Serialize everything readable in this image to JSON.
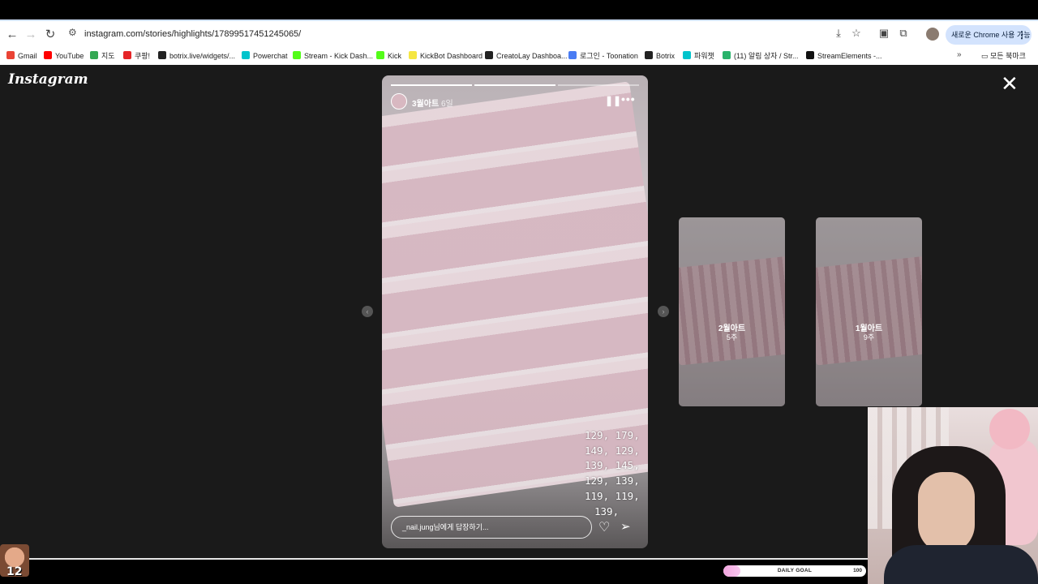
{
  "browser": {
    "url": "instagram.com/stories/highlights/17899517451245065/",
    "update_label": "새로운 Chrome 사용 가능",
    "bookmarks": [
      {
        "label": "Gmail",
        "color": "#ea4335"
      },
      {
        "label": "YouTube",
        "color": "#ff0000"
      },
      {
        "label": "지도",
        "color": "#34a853"
      },
      {
        "label": "쿠팡!",
        "color": "#e52528"
      },
      {
        "label": "botrix.live/widgets/...",
        "color": "#222222"
      },
      {
        "label": "Powerchat",
        "color": "#00c4cc"
      },
      {
        "label": "Stream - Kick Dash...",
        "color": "#53fc18"
      },
      {
        "label": "Kick",
        "color": "#53fc18"
      },
      {
        "label": "KickBot Dashboard",
        "color": "#f5e642"
      },
      {
        "label": "CreatoLay Dashboa...",
        "color": "#222222"
      },
      {
        "label": "로그인 - Toonation",
        "color": "#4a7cf3"
      },
      {
        "label": "Botrix",
        "color": "#222222"
      },
      {
        "label": "파워챗",
        "color": "#00c4cc"
      },
      {
        "label": "(11) 알림 상자 / Str...",
        "color": "#29b36b"
      },
      {
        "label": "StreamElements -...",
        "color": "#111111"
      }
    ],
    "bookmarks_folder": "모든 북마크"
  },
  "instagram": {
    "logo": "Instagram",
    "story": {
      "title": "3월아트",
      "time": "6일",
      "prices": [
        "129, 179,",
        "149, 129,",
        "139, 145,",
        "129, 139,",
        "119, 119,",
        "139,"
      ],
      "reply_placeholder": "_nail.jung님에게 답장하기...",
      "progress_segments": 3,
      "progress_done": 2
    },
    "highlights": [
      {
        "title": "2월아트",
        "ago": "5주"
      },
      {
        "title": "1월아트",
        "ago": "9주"
      }
    ]
  },
  "stream_overlay": {
    "sub_count": "12",
    "goal_label": "DAILY GOAL",
    "goal_max": "100",
    "goal_progress_fraction": 0.12
  }
}
